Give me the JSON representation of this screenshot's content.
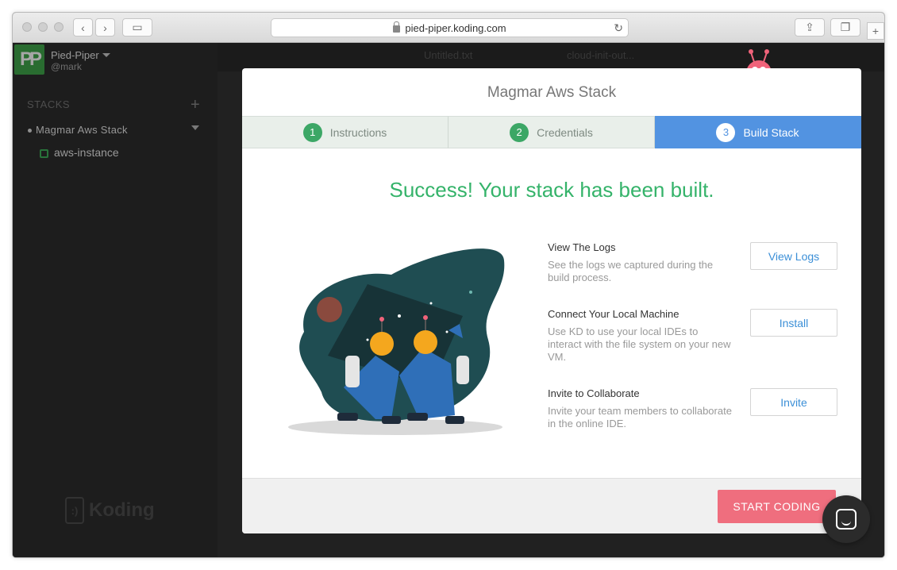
{
  "browser": {
    "url": "pied-piper.koding.com"
  },
  "sidebar": {
    "team_initials": "PP",
    "team_name": "Pied-Piper",
    "username": "@mark",
    "stacks_title": "STACKS",
    "stack_name": "Magmar  Aws  Stack",
    "vm_name": "aws-instance",
    "logo_text": "Koding"
  },
  "workspace": {
    "tabs": [
      "Untitled.txt",
      "cloud-init-out..."
    ]
  },
  "modal": {
    "title": "Magmar Aws Stack",
    "steps": [
      {
        "num": "1",
        "label": "Instructions"
      },
      {
        "num": "2",
        "label": "Credentials"
      },
      {
        "num": "3",
        "label": "Build Stack"
      }
    ],
    "success_message": "Success! Your stack has been built.",
    "actions": [
      {
        "title": "View The Logs",
        "desc": "See the logs we captured during the build process.",
        "button": "View Logs"
      },
      {
        "title": "Connect Your Local Machine",
        "desc": "Use KD to use your local IDEs to interact with the file system on your new VM.",
        "button": "Install"
      },
      {
        "title": "Invite to Collaborate",
        "desc": "Invite your team members to collaborate in the online IDE.",
        "button": "Invite"
      }
    ],
    "start_button": "START CODING"
  },
  "colors": {
    "accent_green": "#35b36a",
    "active_step_blue": "#5293e1",
    "start_button_pink": "#ef6e7e"
  }
}
